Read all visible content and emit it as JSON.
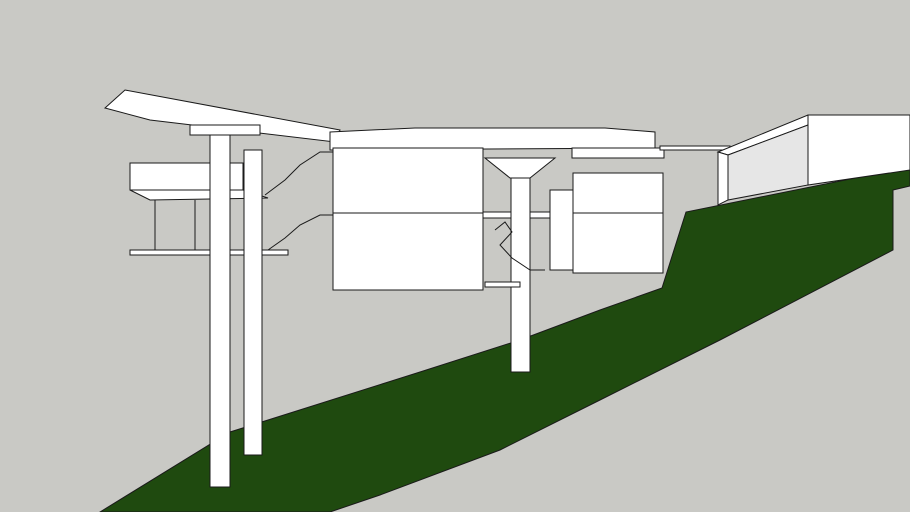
{
  "colors": {
    "sky": "#c9c9c5",
    "ground": "#1f4a0f",
    "ground_shadow": "#183c0a",
    "surface": "#ffffff",
    "surface_shade": "#e6e6e6",
    "edge": "#1a1a1a"
  }
}
